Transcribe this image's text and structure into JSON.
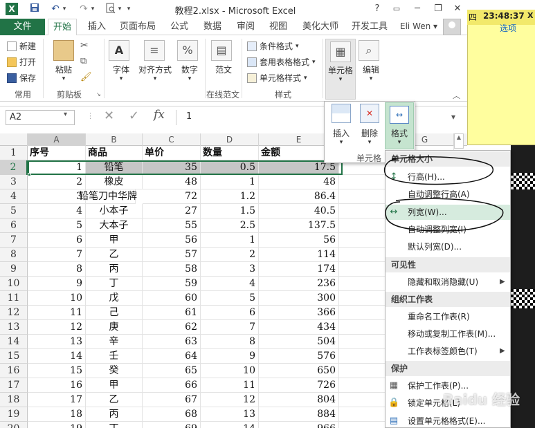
{
  "window": {
    "title": "教程2.xlsx - Microsoft Excel",
    "min": "─",
    "restore": "❐",
    "close": "✕",
    "help": "?",
    "logo": "X"
  },
  "quick_access": {
    "save_icon": "save-icon",
    "undo_icon": "undo-icon",
    "redo_icon": "redo-icon",
    "preview_icon": "print-preview-icon"
  },
  "tabs": [
    "文件",
    "开始",
    "插入",
    "页面布局",
    "公式",
    "数据",
    "审阅",
    "视图",
    "美化大师",
    "开发工具"
  ],
  "user": {
    "name": "Eli Wen",
    "arrow": "▾"
  },
  "ribbon": {
    "clipboard": {
      "new": "新建",
      "open": "打开",
      "save": "保存",
      "paste": "粘贴",
      "group1": "常用",
      "group2": "剪贴板"
    },
    "font": "字体",
    "alignment": "对齐方式",
    "number": "数字",
    "template": "范文",
    "group_template": "在线范文",
    "styles": {
      "conditional": "条件格式",
      "table": "套用表格格式",
      "cell": "单元格样式",
      "group": "样式"
    },
    "cells": "单元格",
    "editing": "编辑"
  },
  "formula_bar": {
    "name_box": "A2",
    "fx": "fx",
    "value": "1",
    "cancel": "✕",
    "enter": "✓"
  },
  "columns": [
    "A",
    "B",
    "C",
    "D",
    "E",
    "F",
    "G"
  ],
  "sheet": {
    "headers": [
      "序号",
      "商品",
      "单价",
      "数量",
      "金额"
    ],
    "rows": [
      [
        "1",
        "铅笔",
        "35",
        "0.5",
        "17.5"
      ],
      [
        "2",
        "橡皮",
        "48",
        "1",
        "48"
      ],
      [
        "3",
        "铅笔刀中华牌",
        "72",
        "1.2",
        "86.4"
      ],
      [
        "4",
        "小本子",
        "27",
        "1.5",
        "40.5"
      ],
      [
        "5",
        "大本子",
        "55",
        "2.5",
        "137.5"
      ],
      [
        "6",
        "甲",
        "56",
        "1",
        "56"
      ],
      [
        "7",
        "乙",
        "57",
        "2",
        "114"
      ],
      [
        "8",
        "丙",
        "58",
        "3",
        "174"
      ],
      [
        "9",
        "丁",
        "59",
        "4",
        "236"
      ],
      [
        "10",
        "戊",
        "60",
        "5",
        "300"
      ],
      [
        "11",
        "己",
        "61",
        "6",
        "366"
      ],
      [
        "12",
        "庚",
        "62",
        "7",
        "434"
      ],
      [
        "13",
        "辛",
        "63",
        "8",
        "504"
      ],
      [
        "14",
        "壬",
        "64",
        "9",
        "576"
      ],
      [
        "15",
        "癸",
        "65",
        "10",
        "650"
      ],
      [
        "16",
        "甲",
        "66",
        "11",
        "726"
      ],
      [
        "17",
        "乙",
        "67",
        "12",
        "804"
      ],
      [
        "18",
        "丙",
        "68",
        "13",
        "884"
      ],
      [
        "19",
        "丁",
        "69",
        "14",
        "966"
      ]
    ],
    "row_numbers": [
      "1",
      "2",
      "3",
      "4",
      "5",
      "6",
      "7",
      "8",
      "9",
      "10",
      "11",
      "12",
      "13",
      "14",
      "15",
      "16",
      "17",
      "18",
      "19",
      "20"
    ]
  },
  "cells_panel": {
    "insert": "插入",
    "delete": "删除",
    "format": "格式",
    "group": "单元格"
  },
  "format_menu": {
    "section_size": "单元格大小",
    "row_height": "行高(H)...",
    "autofit_row": "自动调整行高(A)",
    "col_width": "列宽(W)...",
    "autofit_col": "自动调整列宽(I)",
    "default_width": "默认列宽(D)...",
    "section_visibility": "可见性",
    "hide_unhide": "隐藏和取消隐藏(U)",
    "section_organize": "组织工作表",
    "rename": "重命名工作表(R)",
    "move_copy": "移动或复制工作表(M)...",
    "tab_color": "工作表标签颜色(T)",
    "section_protect": "保护",
    "protect_sheet": "保护工作表(P)...",
    "lock_cell": "锁定单元格(L)",
    "format_cells": "设置单元格格式(E)..."
  },
  "sticky": {
    "day": "四",
    "time": "23:48:37",
    "close": "X",
    "options": "选项",
    "arrow": "▾"
  },
  "watermark": "Baidu 经验"
}
